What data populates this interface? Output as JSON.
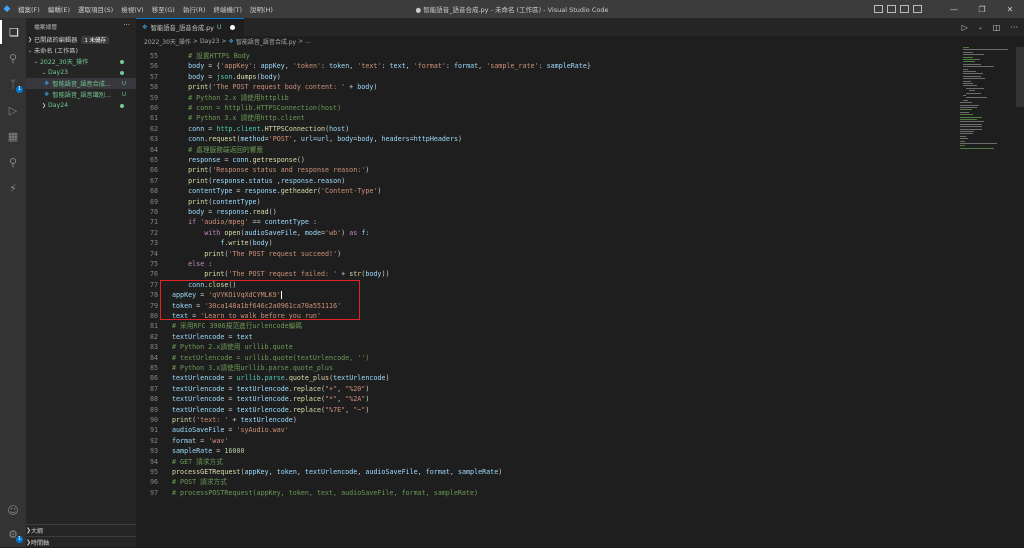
{
  "titlebar": {
    "menu": [
      "檔案(F)",
      "編輯(E)",
      "選取項目(S)",
      "檢視(V)",
      "移至(G)",
      "執行(R)",
      "終端機(T)",
      "說明(H)"
    ],
    "title": "● 智能語音_語音合成.py - 未命名 (工作區) - Visual Studio Code"
  },
  "sidebar": {
    "header": "檔案總管",
    "open_editors": "已開啟的編輯器",
    "unsaved_badge": "1 未儲存",
    "workspace": "未命名 (工作區)",
    "items": [
      {
        "label": "2022_30天_操作",
        "status": "•"
      },
      {
        "label": "Day23",
        "status": "•"
      },
      {
        "label": "智能語音_語音合成...",
        "status": "U"
      },
      {
        "label": "智能語音_語音識別...",
        "status": "U"
      },
      {
        "label": "Day24",
        "status": "•"
      }
    ],
    "outline": "大綱",
    "timeline": "時間軸"
  },
  "activity": {
    "source_control_badge": "1",
    "settings_badge": "1"
  },
  "tab": {
    "label": "智能語音_語音合成.py",
    "status": "U"
  },
  "breadcrumb": [
    "2022_30天_操作",
    "Day23",
    "智能語音_語音合成.py",
    "..."
  ],
  "editor": {
    "lines": [
      {
        "n": "55",
        "i": 2,
        "t": "# 設置HTTPS Body",
        "k": "cm"
      },
      {
        "n": "56",
        "i": 2,
        "t": "body = {'appKey': appKey, 'token': token, 'text': text, 'format': format, 'sample_rate': sampleRate}",
        "k": "mix"
      },
      {
        "n": "57",
        "i": 2,
        "t": "body = json.dumps(body)",
        "k": "mix"
      },
      {
        "n": "58",
        "i": 2,
        "t": "print('The POST request body content: ' + body)",
        "k": "mix"
      },
      {
        "n": "59",
        "i": 2,
        "t": "# Python 2.x 請使用httplib",
        "k": "cm"
      },
      {
        "n": "60",
        "i": 2,
        "t": "# conn = httplib.HTTPSConnection(host)",
        "k": "cm"
      },
      {
        "n": "61",
        "i": 2,
        "t": "# Python 3.x 請使用http.client",
        "k": "cm"
      },
      {
        "n": "62",
        "i": 2,
        "t": "conn = http.client.HTTPSConnection(host)",
        "k": "mix"
      },
      {
        "n": "63",
        "i": 2,
        "t": "conn.request(method='POST', url=url, body=body, headers=httpHeaders)",
        "k": "mix"
      },
      {
        "n": "64",
        "i": 2,
        "t": "# 處理服務端返回的響應",
        "k": "cm"
      },
      {
        "n": "65",
        "i": 2,
        "t": "response = conn.getresponse()",
        "k": "mix"
      },
      {
        "n": "66",
        "i": 2,
        "t": "print('Response status and response reason:')",
        "k": "mix"
      },
      {
        "n": "67",
        "i": 2,
        "t": "print(response.status ,response.reason)",
        "k": "mix"
      },
      {
        "n": "68",
        "i": 2,
        "t": "contentType = response.getheader('Content-Type')",
        "k": "mix"
      },
      {
        "n": "69",
        "i": 2,
        "t": "print(contentType)",
        "k": "mix"
      },
      {
        "n": "70",
        "i": 2,
        "t": "body = response.read()",
        "k": "mix"
      },
      {
        "n": "71",
        "i": 2,
        "t": "if 'audio/mpeg' == contentType :",
        "k": "mix"
      },
      {
        "n": "72",
        "i": 4,
        "t": "with open(audioSaveFile, mode='wb') as f:",
        "k": "mix"
      },
      {
        "n": "73",
        "i": 6,
        "t": "f.write(body)",
        "k": "mix"
      },
      {
        "n": "74",
        "i": 4,
        "t": "print('The POST request succeed!')",
        "k": "mix"
      },
      {
        "n": "75",
        "i": 2,
        "t": "else :",
        "k": "mix"
      },
      {
        "n": "76",
        "i": 4,
        "t": "print('The POST request failed: ' + str(body))",
        "k": "mix"
      },
      {
        "n": "77",
        "i": 2,
        "t": "conn.close()",
        "k": "mix"
      },
      {
        "n": "78",
        "i": 0,
        "t": "appKey = 'qVYKOiVqXdCYMLK9'",
        "k": "mix"
      },
      {
        "n": "79",
        "i": 0,
        "t": "token = '30ca148a1bf646c2a0961ca70a551116'",
        "k": "mix"
      },
      {
        "n": "80",
        "i": 0,
        "t": "text = 'Learn to walk before you run'",
        "k": "mix"
      },
      {
        "n": "81",
        "i": 0,
        "t": "# 采用RFC 3986規范進行urlencode編碼",
        "k": "cm"
      },
      {
        "n": "82",
        "i": 0,
        "t": "textUrlencode = text",
        "k": "mix"
      },
      {
        "n": "83",
        "i": 0,
        "t": "# Python 2.x請使用 urllib.quote",
        "k": "cm"
      },
      {
        "n": "84",
        "i": 0,
        "t": "# textUrlencode = urllib.quote(textUrlencode, '')",
        "k": "cm"
      },
      {
        "n": "85",
        "i": 0,
        "t": "# Python 3.x請使用urllib.parse.quote_plus",
        "k": "cm"
      },
      {
        "n": "86",
        "i": 0,
        "t": "textUrlencode = urllib.parse.quote_plus(textUrlencode)",
        "k": "mix"
      },
      {
        "n": "87",
        "i": 0,
        "t": "textUrlencode = textUrlencode.replace(\"+\", \"%20\")",
        "k": "mix"
      },
      {
        "n": "88",
        "i": 0,
        "t": "textUrlencode = textUrlencode.replace(\"*\", \"%2A\")",
        "k": "mix"
      },
      {
        "n": "89",
        "i": 0,
        "t": "textUrlencode = textUrlencode.replace(\"%7E\", \"~\")",
        "k": "mix"
      },
      {
        "n": "90",
        "i": 0,
        "t": "print('text: ' + textUrlencode)",
        "k": "mix"
      },
      {
        "n": "91",
        "i": 0,
        "t": "audioSaveFile = 'syAudio.wav'",
        "k": "mix"
      },
      {
        "n": "92",
        "i": 0,
        "t": "format = 'wav'",
        "k": "mix"
      },
      {
        "n": "93",
        "i": 0,
        "t": "sampleRate = 16000",
        "k": "mix"
      },
      {
        "n": "94",
        "i": 0,
        "t": "# GET 請求方式",
        "k": "cm"
      },
      {
        "n": "95",
        "i": 0,
        "t": "processGETRequest(appKey, token, textUrlencode, audioSaveFile, format, sampleRate)",
        "k": "mix"
      },
      {
        "n": "96",
        "i": 0,
        "t": "# POST 請求方式",
        "k": "cm"
      },
      {
        "n": "97",
        "i": 0,
        "t": "# processPOSTRequest(appKey, token, text, audioSaveFile, format, sampleRate)",
        "k": "cm"
      }
    ]
  },
  "colors": {
    "accent": "#0078d4",
    "highlight_box": "#e02424"
  }
}
